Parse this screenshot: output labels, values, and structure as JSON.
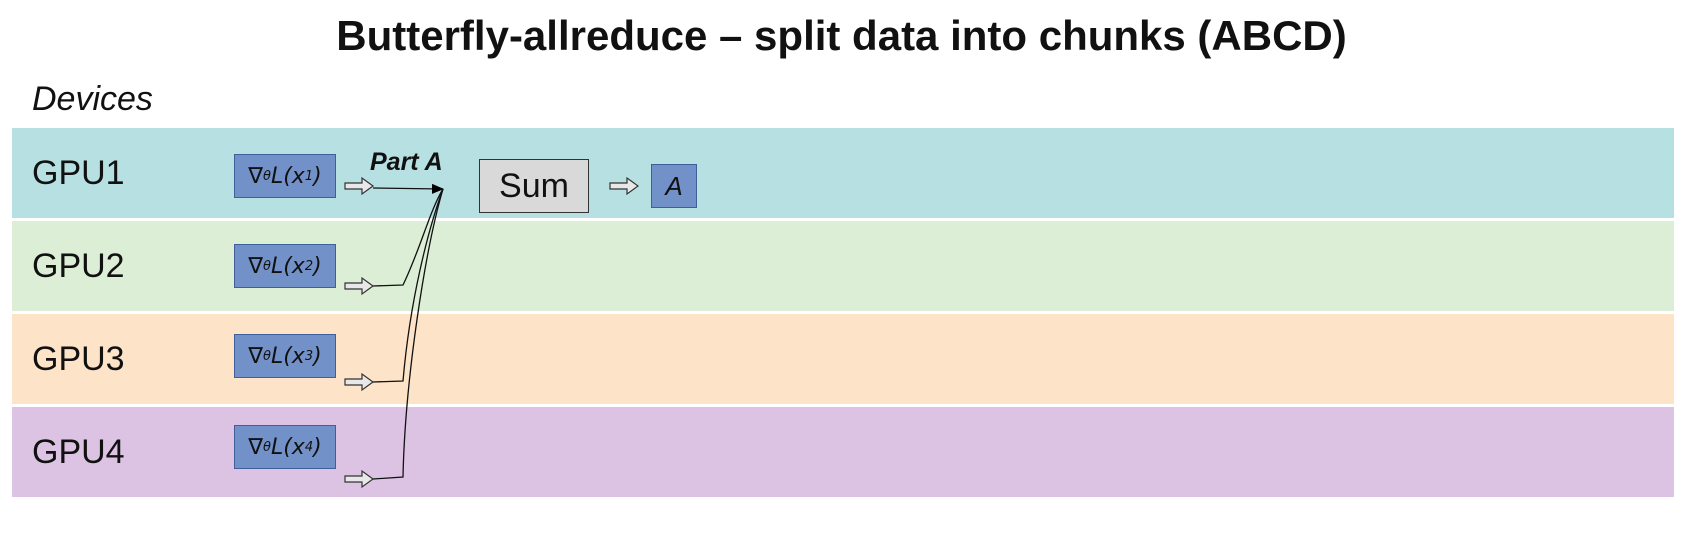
{
  "title": "Butterfly-allreduce – split data into chunks (ABCD)",
  "devices_label": "Devices",
  "lanes": [
    {
      "label": "GPU1",
      "color": "#b6e0e1",
      "subscript": "1"
    },
    {
      "label": "GPU2",
      "color": "#dceed5",
      "subscript": "2"
    },
    {
      "label": "GPU3",
      "color": "#fde4c8",
      "subscript": "3"
    },
    {
      "label": "GPU4",
      "color": "#ddc3e3",
      "subscript": "4"
    }
  ],
  "gradient": {
    "nabla": "∇",
    "theta": "θ",
    "loss": "L(x",
    "close": ")"
  },
  "part_label": "Part A",
  "sum_label": "Sum",
  "result_label": "A",
  "colors": {
    "gradient_box": "#7391c9",
    "sum_box": "#d9d9d9"
  }
}
